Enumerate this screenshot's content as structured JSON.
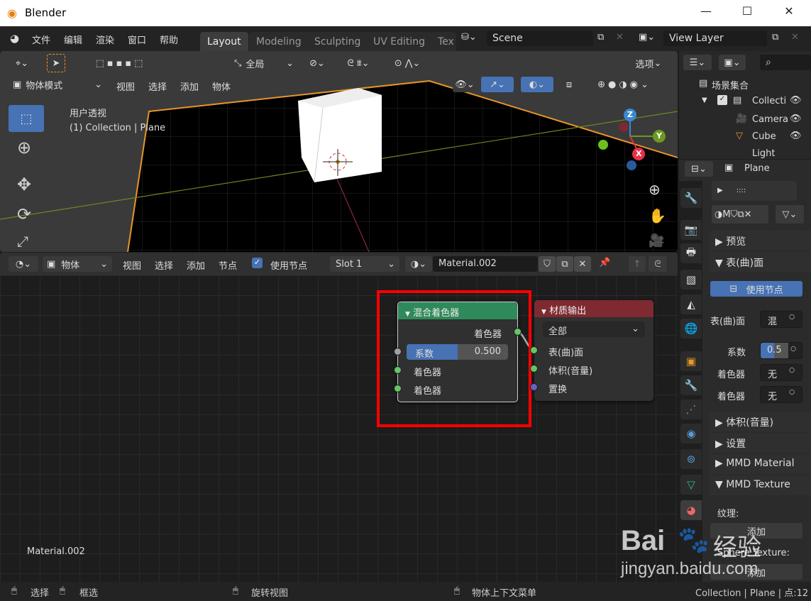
{
  "window": {
    "title": "Blender",
    "minimize": "—",
    "maximize": "☐",
    "close": "✕"
  },
  "menu": [
    "文件",
    "编辑",
    "渲染",
    "窗口",
    "帮助"
  ],
  "workspace_tabs": [
    "Layout",
    "Modeling",
    "Sculpting",
    "UV Editing",
    "Tex"
  ],
  "scene": "Scene",
  "view_layer": "View Layer",
  "viewport": {
    "orientation": "全局",
    "options": "选项",
    "mode": "物体模式",
    "menus": [
      "视图",
      "选择",
      "添加",
      "物体"
    ],
    "overlay_title": "用户透视",
    "overlay_sub": "(1) Collection | Plane",
    "gizmo": {
      "x": "X",
      "y": "Y",
      "z": "Z"
    }
  },
  "node_editor": {
    "type": "物体",
    "menus": [
      "视图",
      "选择",
      "添加",
      "节点"
    ],
    "use_nodes_label": "使用节点",
    "use_nodes_checked": true,
    "slot": "Slot 1",
    "material": "Material.002",
    "footer_label": "Material.002",
    "mix_node": {
      "title": "混合着色器",
      "output": "着色器",
      "factor_label": "系数",
      "factor_value": "0.500",
      "factor": 0.5,
      "inputs": [
        "着色器",
        "着色器"
      ],
      "color": "#2e8a5a"
    },
    "output_node": {
      "title": "材质输出",
      "target": "全部",
      "inputs": [
        "表(曲)面",
        "体积(音量)",
        "置换"
      ],
      "color": "#7e2a30"
    },
    "highlight_color": "#ff0000"
  },
  "outliner": {
    "root": "场景集合",
    "items": [
      "Collecti",
      "Camera",
      "Cube",
      "Light"
    ]
  },
  "properties": {
    "object": "Plane",
    "material_short": "M",
    "sections": {
      "preview": "预览",
      "surface": "表(曲)面",
      "volume": "体积(音量)",
      "settings": "设置",
      "mmd_material": "MMD Material",
      "mmd_texture": "MMD Texture"
    },
    "use_nodes": "使用节点",
    "surface_label": "表(曲)面",
    "surface_value": "混",
    "factor_label": "系数",
    "factor_value": "0.5",
    "shader1_label": "着色器",
    "shader1_value": "无",
    "shader2_label": "着色器",
    "shader2_value": "无",
    "texture_label": "纹理:",
    "texture_add": "添加",
    "sphere_label": "Sphere Texture:",
    "sphere_add": "添加"
  },
  "statusbar": {
    "select": "选择",
    "box_select": "框选",
    "rotate": "旋转视图",
    "context_menu": "物体上下文菜单",
    "info": "Collection | Plane | 点:12 |"
  },
  "watermark": "Baidu 经验 jingyan.baidu.com"
}
